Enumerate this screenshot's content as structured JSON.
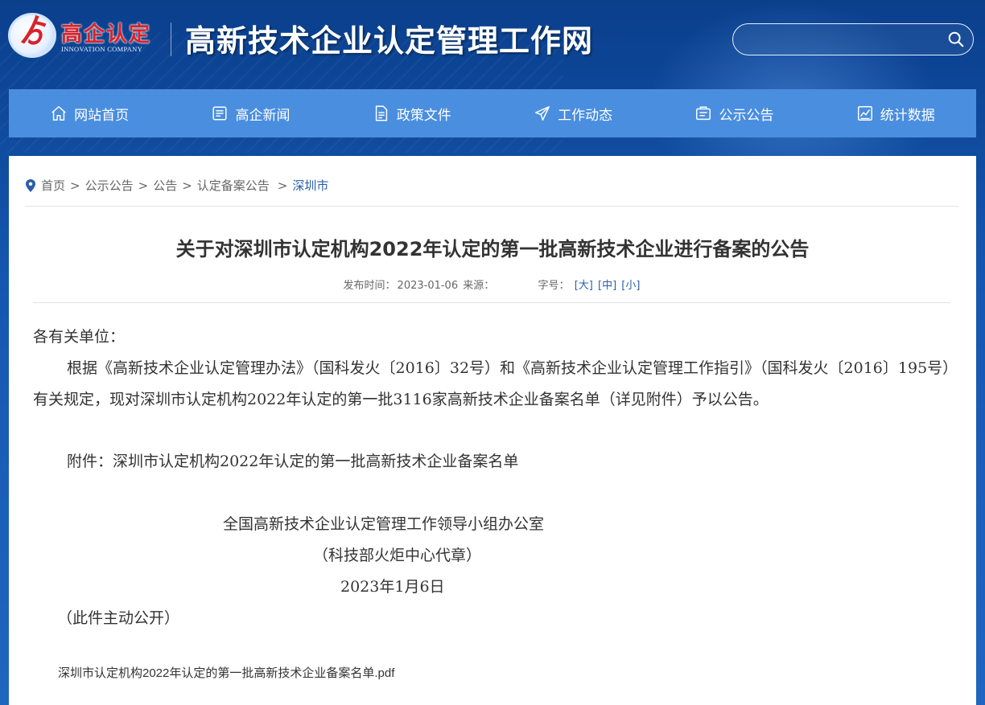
{
  "header": {
    "logo_cn": "高企认定",
    "logo_en": "INNOVATION COMPANY",
    "site_title": "高新技术企业认定管理工作网",
    "search_placeholder": ""
  },
  "nav": {
    "items": [
      {
        "label": "网站首页",
        "icon": "home-icon"
      },
      {
        "label": "高企新闻",
        "icon": "news-icon"
      },
      {
        "label": "政策文件",
        "icon": "document-icon"
      },
      {
        "label": "工作动态",
        "icon": "send-icon"
      },
      {
        "label": "公示公告",
        "icon": "announcement-icon"
      },
      {
        "label": "统计数据",
        "icon": "chart-icon"
      }
    ]
  },
  "breadcrumb": {
    "items": [
      "首页",
      "公示公告",
      "公告",
      "认定备案公告"
    ],
    "separator": ">",
    "current": "深圳市"
  },
  "article": {
    "title": "关于对深圳市认定机构2022年认定的第一批高新技术企业进行备案的公告",
    "meta": {
      "publish_label": "发布时间：",
      "publish_date": "2023-01-06",
      "source_label": "来源：",
      "source": "",
      "font_size_label": "字号：",
      "size_large": "[大]",
      "size_medium": "[中]",
      "size_small": "[小]"
    },
    "salutation": "各有关单位：",
    "paragraph": "根据《高新技术企业认定管理办法》（国科发火〔2016〕32号）和《高新技术企业认定管理工作指引》（国科发火〔2016〕195号）有关规定，现对深圳市认定机构2022年认定的第一批3116家高新技术企业备案名单（详见附件）予以公告。",
    "attachment_line": "附件：深圳市认定机构2022年认定的第一批高新技术企业备案名单",
    "signature_org": "全国高新技术企业认定管理工作领导小组办公室",
    "signature_seal": "（科技部火炬中心代章）",
    "signature_date": "2023年1月6日",
    "disclosure": "（此件主动公开）",
    "attachment_file": "深圳市认定机构2022年认定的第一批高新技术企业备案名单.pdf"
  },
  "colors": {
    "nav_bg": "#4a8ee0",
    "header_bg": "#1557b0",
    "logo_red": "#d8222a",
    "link_blue": "#2b5fa8"
  }
}
